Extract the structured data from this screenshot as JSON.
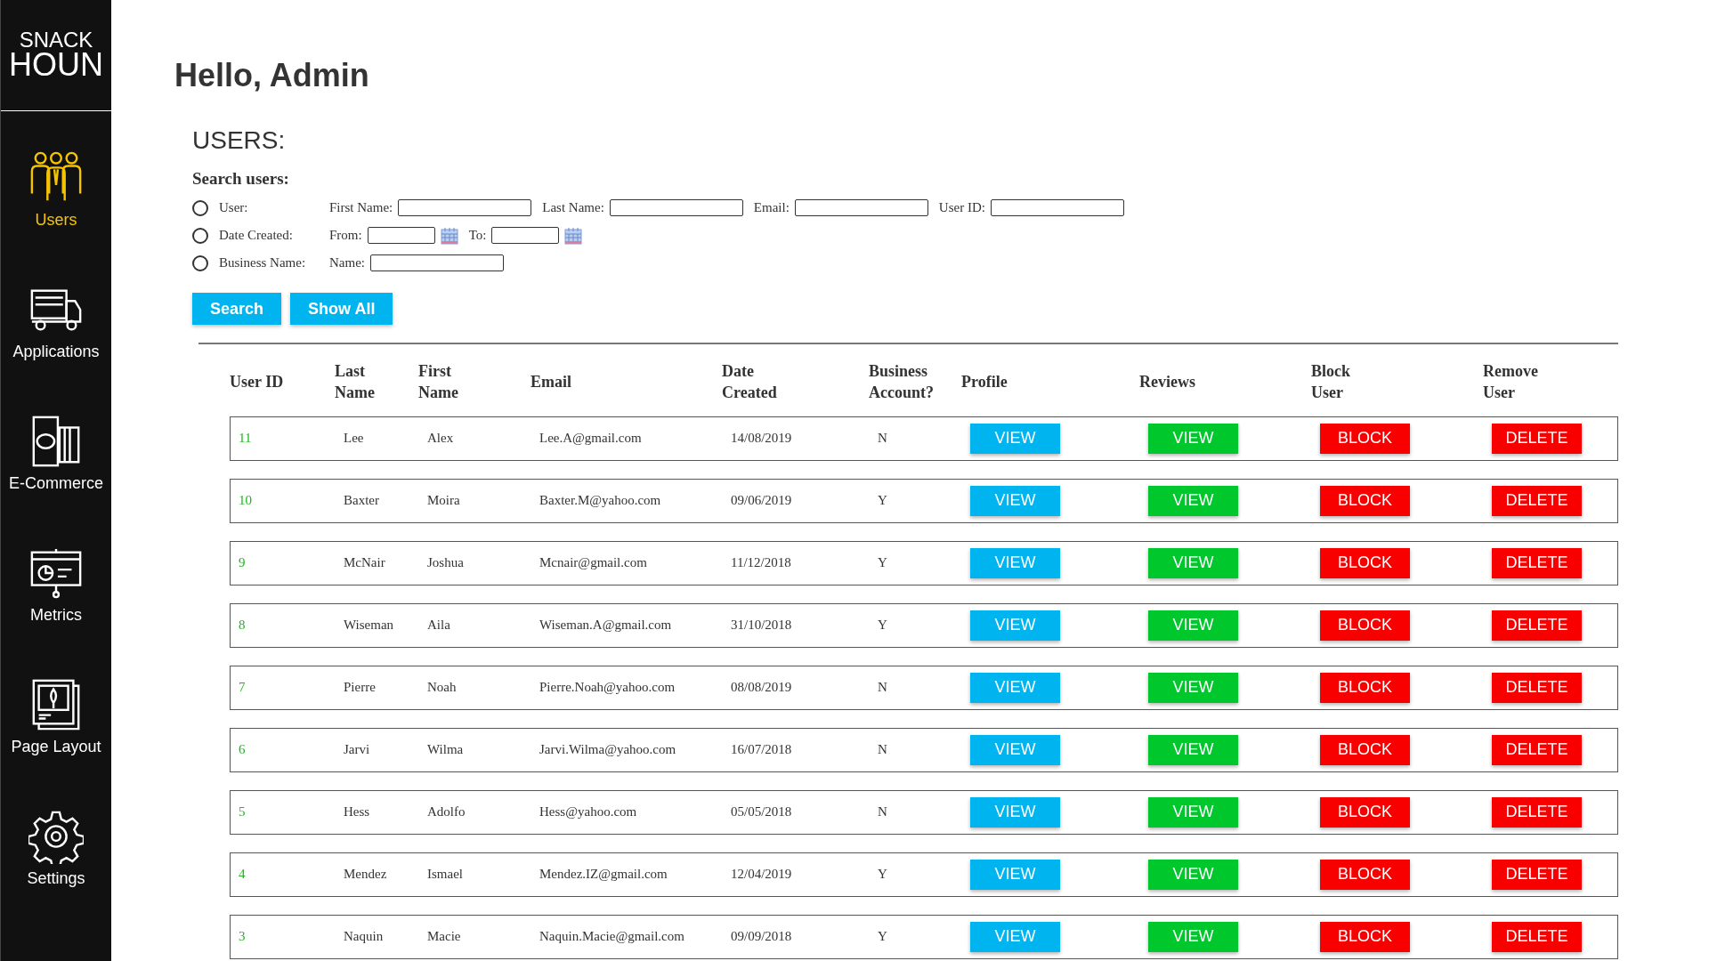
{
  "logo": {
    "line_1": "SNACK",
    "line_2": "HOUN"
  },
  "sidebar": {
    "items": [
      {
        "label": "Users",
        "kind": "users",
        "selected": true
      },
      {
        "label": "Applications",
        "kind": "truck",
        "selected": false
      },
      {
        "label": "E-Commerce",
        "kind": "commerce",
        "selected": false
      },
      {
        "label": "Metrics",
        "kind": "metrics",
        "selected": false
      },
      {
        "label": "Page Layout",
        "kind": "layout",
        "selected": false
      },
      {
        "label": "Settings",
        "kind": "settings",
        "selected": false
      }
    ]
  },
  "greeting": "Hello, Admin",
  "section_title": "USERS:",
  "search": {
    "title": "Search users:",
    "options": [
      {
        "label": "User:",
        "checked": false,
        "fields": [
          {
            "label": "First Name:"
          },
          {
            "label": "Last Name:"
          },
          {
            "label": "Email:"
          },
          {
            "label": "User ID:"
          }
        ]
      },
      {
        "label": "Date Created:",
        "checked": false,
        "fields": [
          {
            "label": "From:",
            "kind": "date"
          },
          {
            "label": "To:",
            "kind": "date"
          }
        ]
      },
      {
        "label": "Business Name:",
        "checked": false,
        "fields": [
          {
            "label": "Name:"
          }
        ]
      }
    ],
    "buttons": [
      "Search",
      "Show All"
    ]
  },
  "table": {
    "columns": [
      "User ID",
      "Last Name",
      "First Name",
      "Email",
      "Date Created",
      "Business Account?",
      "Profile",
      "Reviews",
      "Block User",
      "Remove User"
    ],
    "rows": [
      {
        "id": "11",
        "last": "Lee",
        "first": "Alex",
        "email": "Lee.A@gmail.com",
        "date": "14/08/2019",
        "business": "N",
        "actions": [
          "VIEW",
          "VIEW",
          "BLOCK",
          "DELETE"
        ]
      },
      {
        "id": "10",
        "last": "Baxter",
        "first": "Moira",
        "email": "Baxter.M@yahoo.com",
        "date": "09/06/2019",
        "business": "Y",
        "actions": [
          "VIEW",
          "VIEW",
          "BLOCK",
          "DELETE"
        ]
      },
      {
        "id": "9",
        "last": "McNair",
        "first": "Joshua",
        "email": "Mcnair@gmail.com",
        "date": "11/12/2018",
        "business": "Y",
        "actions": [
          "VIEW",
          "VIEW",
          "BLOCK",
          "DELETE"
        ]
      },
      {
        "id": "8",
        "last": "Wiseman",
        "first": "Aila",
        "email": "Wiseman.A@gmail.com",
        "date": "31/10/2018",
        "business": "Y",
        "actions": [
          "VIEW",
          "VIEW",
          "BLOCK",
          "DELETE"
        ]
      },
      {
        "id": "7",
        "last": "Pierre",
        "first": "Noah",
        "email": "Pierre.Noah@yahoo.com",
        "date": "08/08/2019",
        "business": "N",
        "actions": [
          "VIEW",
          "VIEW",
          "BLOCK",
          "DELETE"
        ]
      },
      {
        "id": "6",
        "last": "Jarvi",
        "first": "Wilma",
        "email": "Jarvi.Wilma@yahoo.com",
        "date": "16/07/2018",
        "business": "N",
        "actions": [
          "VIEW",
          "VIEW",
          "BLOCK",
          "DELETE"
        ]
      },
      {
        "id": "5",
        "last": "Hess",
        "first": "Adolfo",
        "email": "Hess@yahoo.com",
        "date": "05/05/2018",
        "business": "N",
        "actions": [
          "VIEW",
          "VIEW",
          "BLOCK",
          "DELETE"
        ]
      },
      {
        "id": "4",
        "last": "Mendez",
        "first": "Ismael",
        "email": "Mendez.IZ@gmail.com",
        "date": "12/04/2019",
        "business": "Y",
        "actions": [
          "VIEW",
          "VIEW",
          "BLOCK",
          "DELETE"
        ]
      },
      {
        "id": "3",
        "last": "Naquin",
        "first": "Macie",
        "email": "Naquin.Macie@gmail.com",
        "date": "09/09/2018",
        "business": "Y",
        "actions": [
          "VIEW",
          "VIEW",
          "BLOCK",
          "DELETE"
        ]
      }
    ]
  }
}
